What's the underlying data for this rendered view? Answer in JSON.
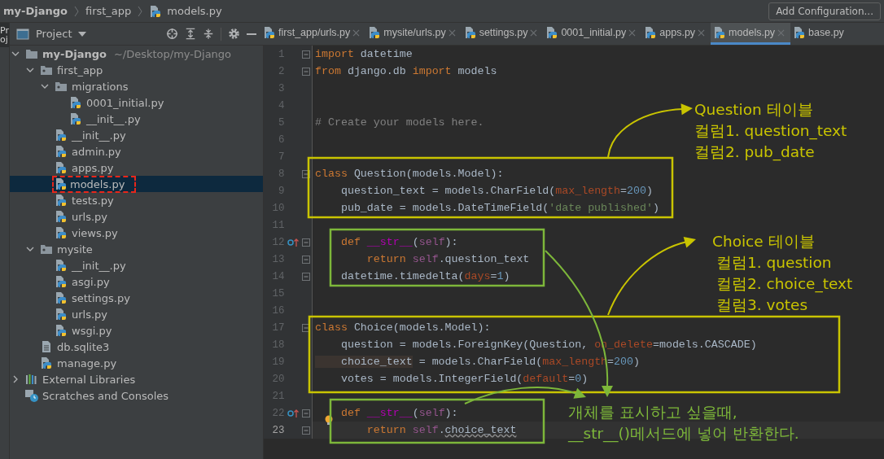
{
  "breadcrumb": [
    {
      "label": "my-Django",
      "kind": "project"
    },
    {
      "label": "first_app",
      "kind": "folder"
    },
    {
      "label": "models.py",
      "kind": "python"
    }
  ],
  "run_config": {
    "label": "Add Configuration..."
  },
  "side_tab": {
    "label": "Proj"
  },
  "project_panel": {
    "title": "Project"
  },
  "tabs": [
    {
      "label": "first_app/urls.py",
      "selected": false
    },
    {
      "label": "mysite/urls.py",
      "selected": false
    },
    {
      "label": "settings.py",
      "selected": false
    },
    {
      "label": "0001_initial.py",
      "selected": false
    },
    {
      "label": "apps.py",
      "selected": false
    },
    {
      "label": "models.py",
      "selected": true
    },
    {
      "label": "base.py",
      "selected": false
    }
  ],
  "tree": [
    {
      "label": "my-Django",
      "kind": "folder",
      "path": "~/Desktop/my-Django",
      "expanded": true,
      "children": [
        {
          "label": "first_app",
          "kind": "package",
          "expanded": true,
          "children": [
            {
              "label": "migrations",
              "kind": "package",
              "expanded": true,
              "children": [
                {
                  "label": "0001_initial.py",
                  "kind": "python",
                  "selected": false,
                  "marked": false
                },
                {
                  "label": "__init__.py",
                  "kind": "python",
                  "selected": false,
                  "marked": false
                }
              ]
            },
            {
              "label": "__init__.py",
              "kind": "python",
              "selected": false,
              "marked": false
            },
            {
              "label": "admin.py",
              "kind": "python",
              "selected": false,
              "marked": false
            },
            {
              "label": "apps.py",
              "kind": "python",
              "selected": false,
              "marked": false
            },
            {
              "label": "models.py",
              "kind": "python",
              "selected": true,
              "marked": true
            },
            {
              "label": "tests.py",
              "kind": "python",
              "selected": false,
              "marked": false
            },
            {
              "label": "urls.py",
              "kind": "python",
              "selected": false,
              "marked": false
            },
            {
              "label": "views.py",
              "kind": "python",
              "selected": false,
              "marked": false
            }
          ]
        },
        {
          "label": "mysite",
          "kind": "package",
          "expanded": true,
          "children": [
            {
              "label": "__init__.py",
              "kind": "python",
              "selected": false,
              "marked": false
            },
            {
              "label": "asgi.py",
              "kind": "python",
              "selected": false,
              "marked": false
            },
            {
              "label": "settings.py",
              "kind": "python",
              "selected": false,
              "marked": false
            },
            {
              "label": "urls.py",
              "kind": "python",
              "selected": false,
              "marked": false
            },
            {
              "label": "wsgi.py",
              "kind": "python",
              "selected": false,
              "marked": false
            }
          ]
        },
        {
          "label": "db.sqlite3",
          "kind": "file",
          "selected": false,
          "marked": false
        },
        {
          "label": "manage.py",
          "kind": "python",
          "selected": false,
          "marked": false
        }
      ]
    },
    {
      "label": "External Libraries",
      "kind": "libraries",
      "expanded": false
    },
    {
      "label": "Scratches and Consoles",
      "kind": "scratches"
    }
  ],
  "code": [
    {
      "number": "1",
      "fold": true,
      "override": false,
      "current": false,
      "tokens": [
        {
          "text": "import",
          "kind": "keyword"
        },
        {
          "text": " datetime",
          "kind": "plain"
        }
      ]
    },
    {
      "number": "2",
      "fold": true,
      "override": false,
      "current": false,
      "tokens": [
        {
          "text": "from",
          "kind": "keyword"
        },
        {
          "text": " django.db ",
          "kind": "plain"
        },
        {
          "text": "import",
          "kind": "keyword"
        },
        {
          "text": " models",
          "kind": "plain"
        }
      ]
    },
    {
      "number": "3",
      "fold": false,
      "override": false,
      "current": false
    },
    {
      "number": "4",
      "fold": false,
      "override": false,
      "current": false
    },
    {
      "number": "5",
      "fold": false,
      "override": false,
      "current": false,
      "tokens": [
        {
          "text": "# Create your models here.",
          "kind": "comment"
        }
      ]
    },
    {
      "number": "6",
      "fold": false,
      "override": false,
      "current": false
    },
    {
      "number": "7",
      "fold": false,
      "override": false,
      "current": false
    },
    {
      "number": "8",
      "fold": true,
      "override": false,
      "current": false,
      "tokens": [
        {
          "text": "class",
          "kind": "keyword"
        },
        {
          "text": " Question(models.Model):",
          "kind": "plain"
        }
      ]
    },
    {
      "number": "9",
      "fold": false,
      "override": false,
      "current": false,
      "tokens": [
        {
          "text": "    question_text = models.CharField(",
          "kind": "plain"
        },
        {
          "text": "max_length",
          "kind": "param"
        },
        {
          "text": "=",
          "kind": "plain"
        },
        {
          "text": "200",
          "kind": "number"
        },
        {
          "text": ")",
          "kind": "plain"
        }
      ]
    },
    {
      "number": "10",
      "fold": false,
      "override": false,
      "current": false,
      "tokens": [
        {
          "text": "    pub_date = models.DateTimeField(",
          "kind": "plain"
        },
        {
          "text": "'date published'",
          "kind": "string"
        },
        {
          "text": ")",
          "kind": "plain"
        }
      ]
    },
    {
      "number": "11",
      "fold": false,
      "override": false,
      "current": false
    },
    {
      "number": "12",
      "fold": true,
      "override": true,
      "current": false,
      "tokens": [
        {
          "text": "    def",
          "kind": "keyword"
        },
        {
          "text": " __str__",
          "kind": "magic"
        },
        {
          "text": "(",
          "kind": "plain"
        },
        {
          "text": "self",
          "kind": "self"
        },
        {
          "text": "):",
          "kind": "plain"
        }
      ]
    },
    {
      "number": "13",
      "fold": true,
      "override": false,
      "current": false,
      "tokens": [
        {
          "text": "        return",
          "kind": "keyword"
        },
        {
          "text": " self",
          "kind": "self"
        },
        {
          "text": ".question_text",
          "kind": "plain"
        }
      ]
    },
    {
      "number": "14",
      "fold": true,
      "override": false,
      "current": false,
      "tokens": [
        {
          "text": "    datetime.timedelta(",
          "kind": "plain"
        },
        {
          "text": "days",
          "kind": "param"
        },
        {
          "text": "=",
          "kind": "plain"
        },
        {
          "text": "1",
          "kind": "number"
        },
        {
          "text": ")",
          "kind": "plain"
        }
      ]
    },
    {
      "number": "15",
      "fold": false,
      "override": false,
      "current": false
    },
    {
      "number": "16",
      "fold": false,
      "override": false,
      "current": false
    },
    {
      "number": "17",
      "fold": true,
      "override": false,
      "current": false,
      "tokens": [
        {
          "text": "class",
          "kind": "keyword"
        },
        {
          "text": " Choice(models.Model):",
          "kind": "plain"
        }
      ]
    },
    {
      "number": "18",
      "fold": false,
      "override": false,
      "current": false,
      "tokens": [
        {
          "text": "    question = models.ForeignKey(Question, ",
          "kind": "plain"
        },
        {
          "text": "on_delete",
          "kind": "param"
        },
        {
          "text": "=models.CASCADE)",
          "kind": "plain"
        }
      ]
    },
    {
      "number": "19",
      "fold": false,
      "override": false,
      "current": false,
      "tokens": [
        {
          "text": "    choice_text",
          "kind": "marked"
        },
        {
          "text": " = models.CharField(",
          "kind": "plain"
        },
        {
          "text": "max_length",
          "kind": "param"
        },
        {
          "text": "=",
          "kind": "plain"
        },
        {
          "text": "200",
          "kind": "number"
        },
        {
          "text": ")",
          "kind": "plain"
        }
      ]
    },
    {
      "number": "20",
      "fold": false,
      "override": false,
      "current": false,
      "tokens": [
        {
          "text": "    votes = models.IntegerField(",
          "kind": "plain"
        },
        {
          "text": "default",
          "kind": "param"
        },
        {
          "text": "=",
          "kind": "plain"
        },
        {
          "text": "0",
          "kind": "number"
        },
        {
          "text": ")",
          "kind": "plain"
        }
      ]
    },
    {
      "number": "21",
      "fold": false,
      "override": false,
      "current": false
    },
    {
      "number": "22",
      "fold": true,
      "override": true,
      "current": false,
      "tokens": [
        {
          "text": "    def",
          "kind": "keyword"
        },
        {
          "text": " __str__",
          "kind": "magic"
        },
        {
          "text": "(",
          "kind": "plain"
        },
        {
          "text": "self",
          "kind": "self"
        },
        {
          "text": "):",
          "kind": "plain"
        }
      ]
    },
    {
      "number": "23",
      "fold": true,
      "override": false,
      "current": true,
      "tokens": [
        {
          "text": "        return",
          "kind": "keyword"
        },
        {
          "text": " self",
          "kind": "self"
        },
        {
          "text": ".",
          "kind": "plain"
        },
        {
          "text": "choice_text",
          "kind": "typo"
        }
      ]
    }
  ],
  "notes": [
    {
      "color": "#c9c400",
      "lines": [
        "Question 테이블",
        "컬럼1. question_text",
        "컬럼2. pub_date"
      ]
    },
    {
      "color": "#c9c400",
      "lines": [
        "Choice 테이블",
        "컬럼1. question",
        "컬럼2. choice_text",
        "컬럼3. votes"
      ]
    },
    {
      "color": "#7db73a",
      "lines": [
        "개체를 표시하고 싶을때,",
        "__str__()메서드에 넣어 반환한다."
      ]
    }
  ],
  "boxes": [
    {
      "color": "#c9c400"
    },
    {
      "color": "#7db73a"
    },
    {
      "color": "#c9c400"
    },
    {
      "color": "#7db73a"
    }
  ]
}
